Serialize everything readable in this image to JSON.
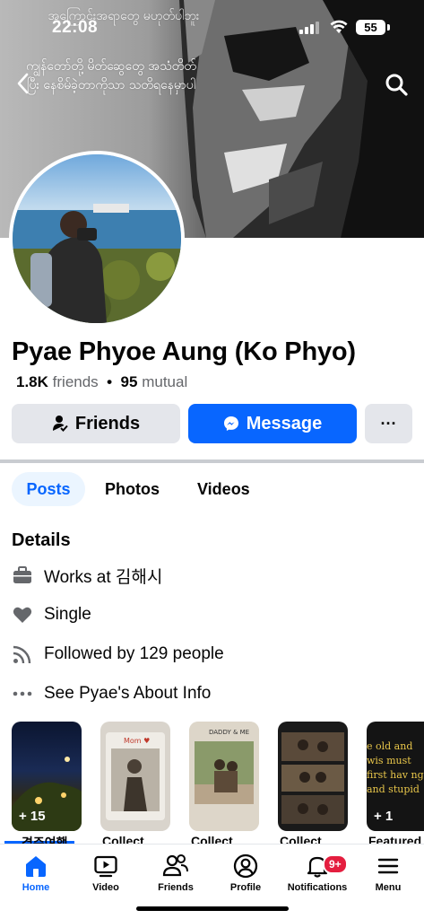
{
  "status_bar": {
    "time": "22:08",
    "battery": "55"
  },
  "cover": {
    "top_text": "အကြောင်းအရာတွေ မဟုတ်ပါဘူး",
    "mid_text": "ကျွန်တော်တို့ မိတ်ဆွေတွေ အသံတိတ်ပြီး နေစိမ်ခဲ့တာကိုသာ သတိရနေမှာပါ"
  },
  "profile": {
    "name": "Pyae Phyoe Aung (Ko Phyo)",
    "friends_count": "1.8K",
    "friends_label": "friends",
    "mutual_count": "95",
    "mutual_label": "mutual",
    "separator": "•"
  },
  "actions": {
    "friends_label": "Friends",
    "message_label": "Message",
    "more_label": "···"
  },
  "tabs": [
    {
      "label": "Posts",
      "active": true
    },
    {
      "label": "Photos"
    },
    {
      "label": "Videos"
    }
  ],
  "details": {
    "title": "Details",
    "items": [
      {
        "icon": "briefcase-icon",
        "text": "Works at 김해시"
      },
      {
        "icon": "heart-icon",
        "text": "Single"
      },
      {
        "icon": "rss-icon",
        "text": "Followed by 129 people"
      },
      {
        "icon": "more-dots-icon",
        "text": "See Pyae's About Info"
      }
    ]
  },
  "highlights": [
    {
      "count": "+ 15",
      "title": "경주여행"
    },
    {
      "count": "",
      "title": "Collect"
    },
    {
      "count": "",
      "title": "Collect"
    },
    {
      "count": "",
      "title": "Collect"
    },
    {
      "count": "+ 1",
      "title": "Featured",
      "text": "e old and wis must first hav ng and stupid"
    }
  ],
  "nav": {
    "items": [
      {
        "label": "Home",
        "icon": "home-icon",
        "active": true
      },
      {
        "label": "Video",
        "icon": "video-icon"
      },
      {
        "label": "Friends",
        "icon": "friends-icon"
      },
      {
        "label": "Profile",
        "icon": "profile-icon"
      },
      {
        "label": "Notifications",
        "icon": "bell-icon",
        "badge": "9+"
      },
      {
        "label": "Menu",
        "icon": "menu-icon"
      }
    ]
  },
  "colors": {
    "accent": "#0866ff",
    "button_gray": "#e4e6eb",
    "secondary_text": "#65676b",
    "badge_red": "#e41e3f"
  }
}
